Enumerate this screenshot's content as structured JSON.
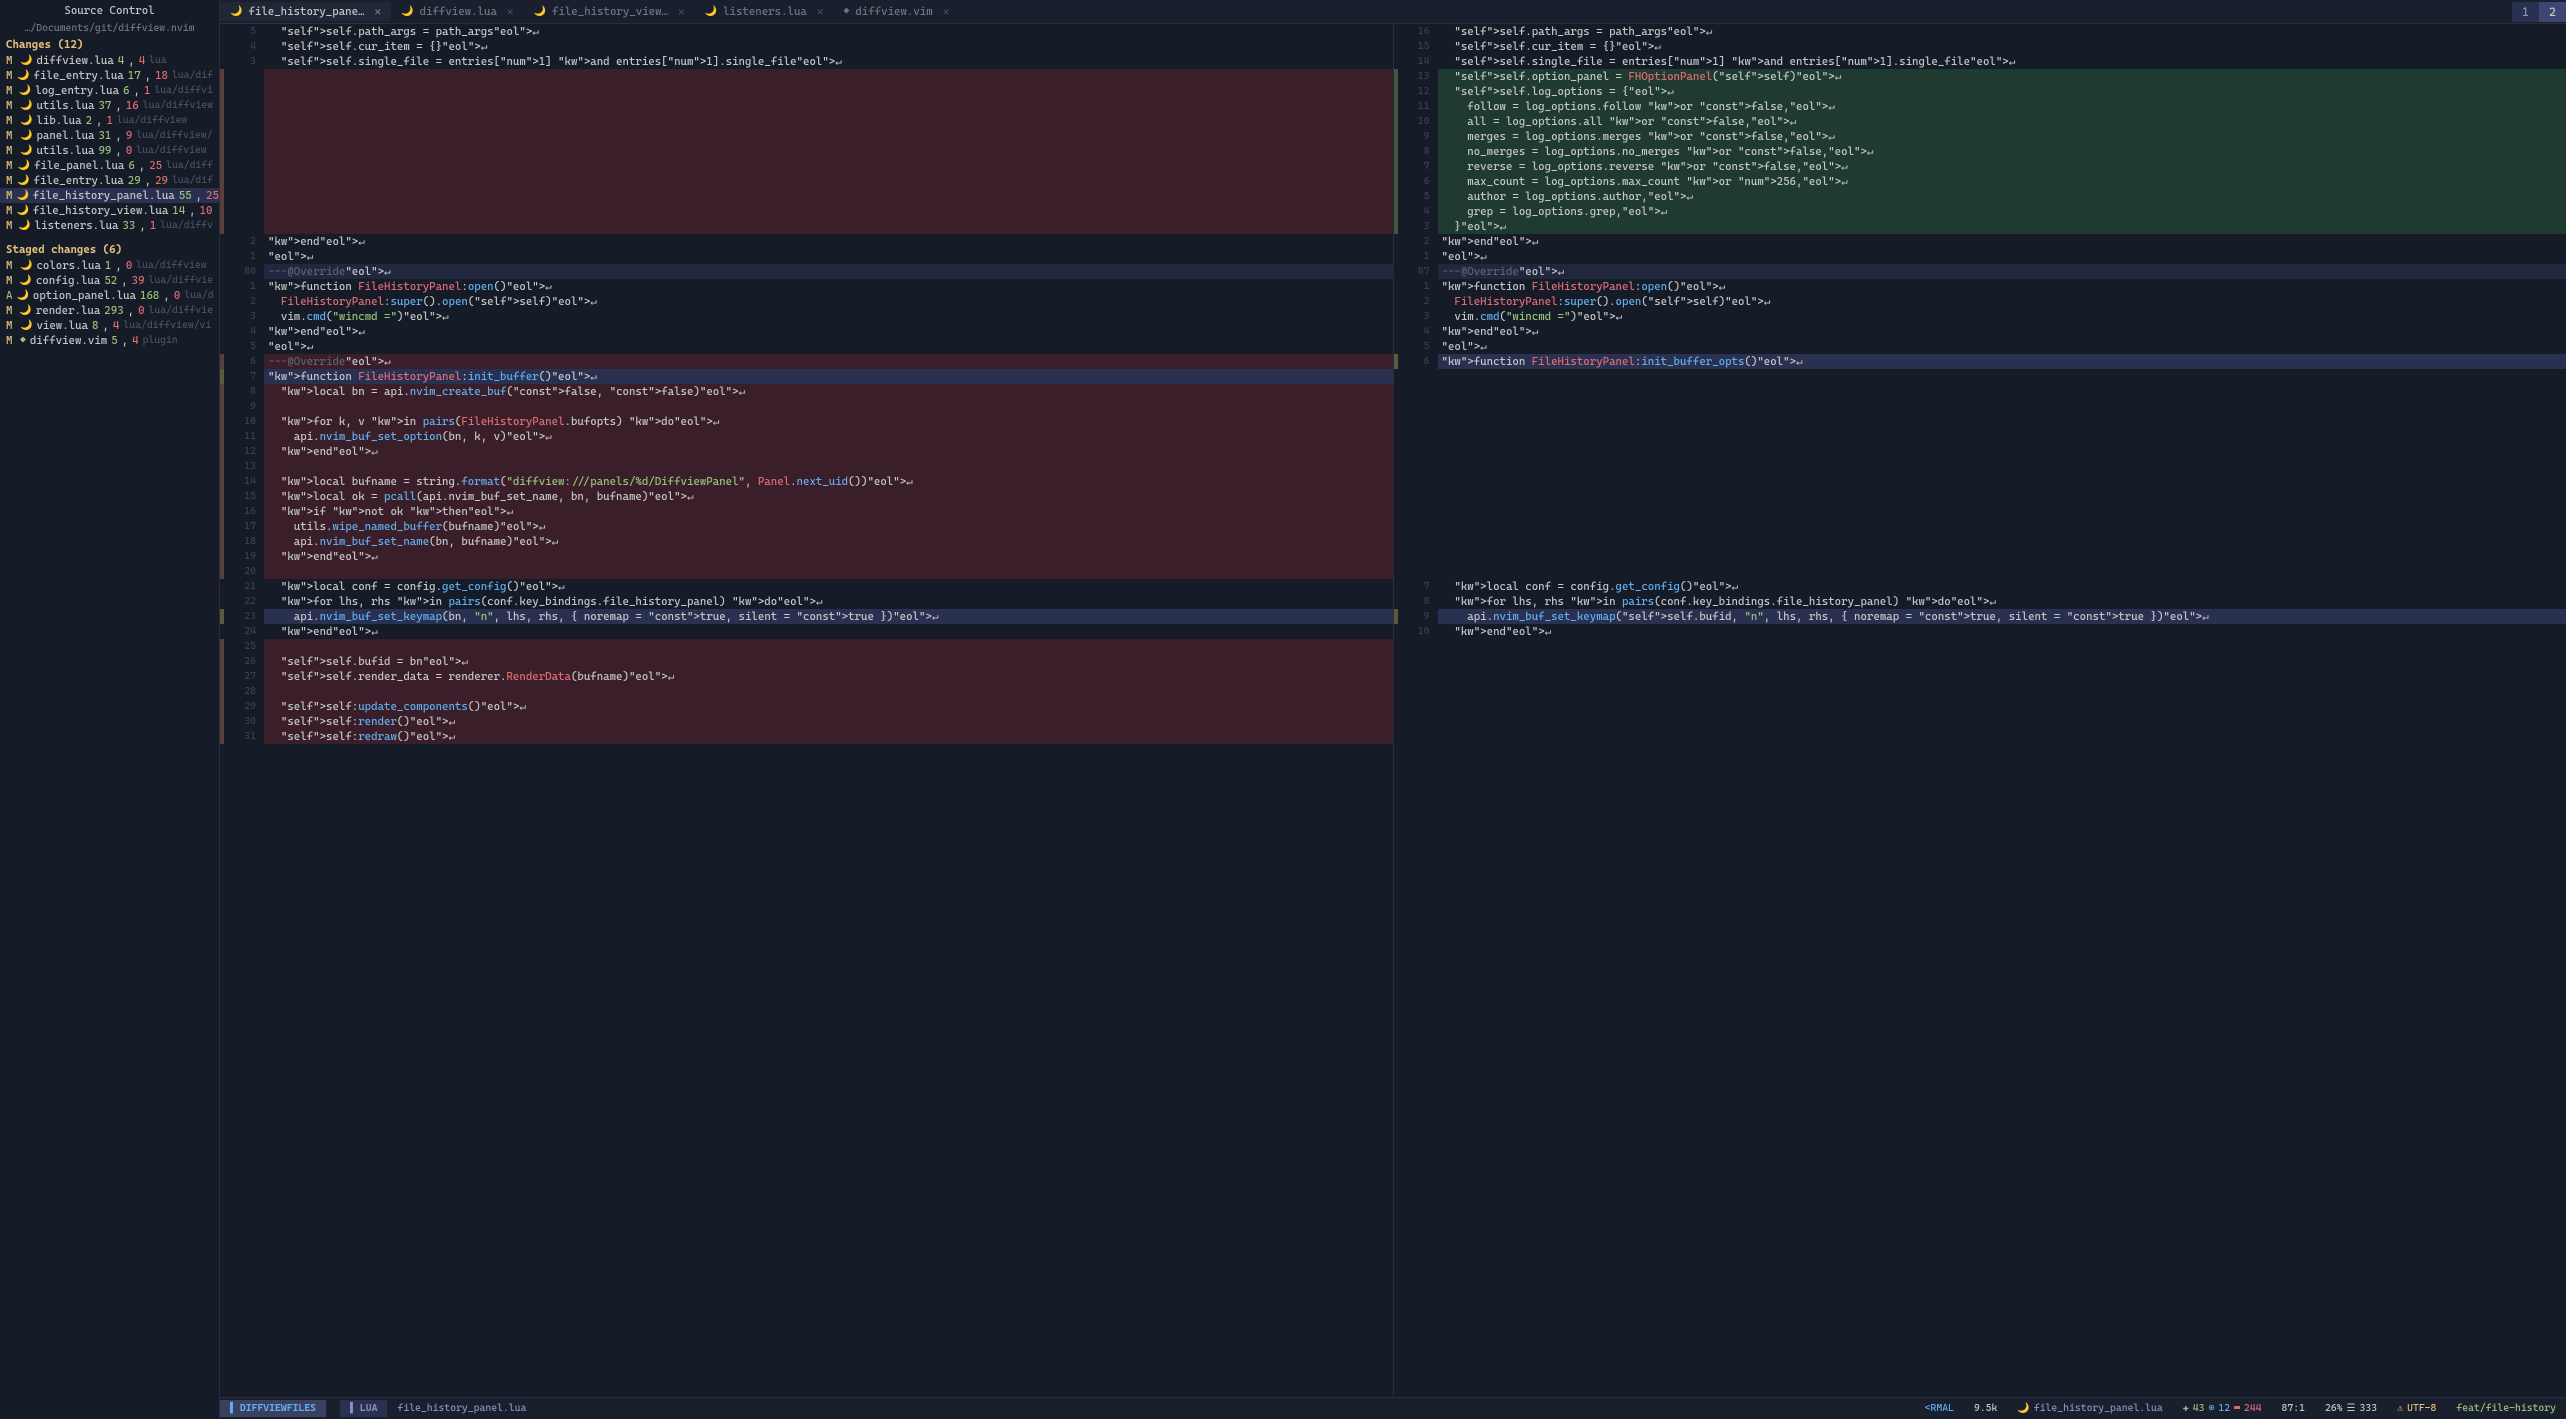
{
  "sidebar": {
    "title": "Source Control",
    "path": "…/Documents/git/diffview.nvim",
    "changes_header": "Changes (12)",
    "changes": [
      {
        "status": "M",
        "name": "diffview.lua",
        "add": "4",
        "del": "4",
        "path": "lua"
      },
      {
        "status": "M",
        "name": "file_entry.lua",
        "add": "17",
        "del": "18",
        "path": "lua/dif"
      },
      {
        "status": "M",
        "name": "log_entry.lua",
        "add": "6",
        "del": "1",
        "path": "lua/diffvi"
      },
      {
        "status": "M",
        "name": "utils.lua",
        "add": "37",
        "del": "16",
        "path": "lua/diffview"
      },
      {
        "status": "M",
        "name": "lib.lua",
        "add": "2",
        "del": "1",
        "path": "lua/diffview"
      },
      {
        "status": "M",
        "name": "panel.lua",
        "add": "31",
        "del": "9",
        "path": "lua/diffview/"
      },
      {
        "status": "M",
        "name": "utils.lua",
        "add": "99",
        "del": "0",
        "path": "lua/diffview"
      },
      {
        "status": "M",
        "name": "file_panel.lua",
        "add": "6",
        "del": "25",
        "path": "lua/diff"
      },
      {
        "status": "M",
        "name": "file_entry.lua",
        "add": "29",
        "del": "29",
        "path": "lua/dif"
      },
      {
        "status": "M",
        "name": "file_history_panel.lua",
        "add": "55",
        "del": "25",
        "path": "",
        "selected": true
      },
      {
        "status": "M",
        "name": "file_history_view.lua",
        "add": "14",
        "del": "10",
        "path": ""
      },
      {
        "status": "M",
        "name": "listeners.lua",
        "add": "33",
        "del": "1",
        "path": "lua/diffv"
      }
    ],
    "staged_header": "Staged changes (6)",
    "staged": [
      {
        "status": "M",
        "name": "colors.lua",
        "add": "1",
        "del": "0",
        "path": "lua/diffview"
      },
      {
        "status": "M",
        "name": "config.lua",
        "add": "52",
        "del": "39",
        "path": "lua/diffvie"
      },
      {
        "status": "A",
        "name": "option_panel.lua",
        "add": "168",
        "del": "0",
        "path": "lua/d"
      },
      {
        "status": "M",
        "name": "render.lua",
        "add": "293",
        "del": "0",
        "path": "lua/diffvie"
      },
      {
        "status": "M",
        "name": "view.lua",
        "add": "8",
        "del": "4",
        "path": "lua/diffview/vi"
      },
      {
        "status": "M",
        "name": "diffview.vim",
        "add": "5",
        "del": "4",
        "path": "plugin",
        "vim": true
      }
    ]
  },
  "tabs": [
    {
      "label": "file_history_pane…",
      "active": true,
      "icon": "🌙"
    },
    {
      "label": "diffview.lua",
      "icon": "🌙"
    },
    {
      "label": "file_history_view…",
      "icon": "🌙"
    },
    {
      "label": "listeners.lua",
      "icon": "🌙"
    },
    {
      "label": "diffview.vim",
      "icon": "◆"
    }
  ],
  "tab_nums": [
    "1",
    "2"
  ],
  "left_pane": {
    "gutter": [
      "5",
      "4",
      "3",
      "",
      "",
      "",
      "",
      "",
      "",
      "",
      "",
      "",
      "",
      "",
      "2",
      "1",
      "80",
      "1",
      "2",
      "3",
      "4",
      "5",
      "6",
      "7",
      "8",
      "9",
      "10",
      "11",
      "12",
      "13",
      "14",
      "15",
      "16",
      "17",
      "18",
      "19",
      "20",
      "21",
      "22",
      "23",
      "24",
      "25",
      "26",
      "27",
      "28",
      "29",
      "30",
      "31"
    ],
    "lines": [
      {
        "t": "  self.path_args = path_args↵"
      },
      {
        "t": "  self.cur_item = {}↵"
      },
      {
        "t": "  self.single_file = entries[1] and entries[1].single_file↵"
      },
      {
        "t": "",
        "cls": "bg-del"
      },
      {
        "t": "",
        "cls": "bg-del"
      },
      {
        "t": "",
        "cls": "bg-del"
      },
      {
        "t": "",
        "cls": "bg-del"
      },
      {
        "t": "",
        "cls": "bg-del"
      },
      {
        "t": "",
        "cls": "bg-del"
      },
      {
        "t": "",
        "cls": "bg-del"
      },
      {
        "t": "",
        "cls": "bg-del"
      },
      {
        "t": "",
        "cls": "bg-del"
      },
      {
        "t": "",
        "cls": "bg-del"
      },
      {
        "t": "",
        "cls": "bg-del"
      },
      {
        "t": "end↵"
      },
      {
        "t": "↵"
      },
      {
        "t": "---@Override↵",
        "cls": "cursor-line"
      },
      {
        "t": "function FileHistoryPanel:open()↵"
      },
      {
        "t": "  FileHistoryPanel:super().open(self)↵"
      },
      {
        "t": "  vim.cmd(\"wincmd =\")↵"
      },
      {
        "t": "end↵"
      },
      {
        "t": "↵"
      },
      {
        "t": "---@Override↵",
        "cls": "bg-del"
      },
      {
        "t": "function FileHistoryPanel:init_buffer()↵",
        "cls": "bg-change"
      },
      {
        "t": "  local bn = api.nvim_create_buf(false, false)↵",
        "cls": "bg-del"
      },
      {
        "t": "",
        "cls": "bg-del"
      },
      {
        "t": "  for k, v in pairs(FileHistoryPanel.bufopts) do↵",
        "cls": "bg-del"
      },
      {
        "t": "    api.nvim_buf_set_option(bn, k, v)↵",
        "cls": "bg-del"
      },
      {
        "t": "  end↵",
        "cls": "bg-del"
      },
      {
        "t": "",
        "cls": "bg-del"
      },
      {
        "t": "  local bufname = string.format(\"diffview:///panels/%d/DiffviewPanel\", Panel.next_uid())↵",
        "cls": "bg-del"
      },
      {
        "t": "  local ok = pcall(api.nvim_buf_set_name, bn, bufname)↵",
        "cls": "bg-del"
      },
      {
        "t": "  if not ok then↵",
        "cls": "bg-del"
      },
      {
        "t": "    utils.wipe_named_buffer(bufname)↵",
        "cls": "bg-del"
      },
      {
        "t": "    api.nvim_buf_set_name(bn, bufname)↵",
        "cls": "bg-del"
      },
      {
        "t": "  end↵",
        "cls": "bg-del"
      },
      {
        "t": "",
        "cls": "bg-del"
      },
      {
        "t": "  local conf = config.get_config()↵"
      },
      {
        "t": "  for lhs, rhs in pairs(conf.key_bindings.file_history_panel) do↵"
      },
      {
        "t": "    api.nvim_buf_set_keymap(bn, \"n\", lhs, rhs, { noremap = true, silent = true })↵",
        "cls": "bg-change"
      },
      {
        "t": "  end↵"
      },
      {
        "t": "",
        "cls": "bg-del"
      },
      {
        "t": "  self.bufid = bn↵",
        "cls": "bg-del"
      },
      {
        "t": "  self.render_data = renderer.RenderData(bufname)↵",
        "cls": "bg-del"
      },
      {
        "t": "",
        "cls": "bg-del"
      },
      {
        "t": "  self:update_components()↵",
        "cls": "bg-del"
      },
      {
        "t": "  self:render()↵",
        "cls": "bg-del"
      },
      {
        "t": "  self:redraw()↵",
        "cls": "bg-del"
      }
    ]
  },
  "right_pane": {
    "gutter": [
      "16",
      "15",
      "14",
      "13",
      "12",
      "11",
      "10",
      "9",
      "8",
      "7",
      "6",
      "5",
      "4",
      "3",
      "2",
      "1",
      "87",
      "1",
      "2",
      "3",
      "4",
      "5",
      "6",
      "",
      "",
      "",
      "",
      "",
      "",
      "",
      "",
      "",
      "",
      "",
      "",
      "",
      "",
      "7",
      "8",
      "9",
      "10"
    ],
    "lines": [
      {
        "t": "  self.path_args = path_args↵"
      },
      {
        "t": "  self.cur_item = {}↵"
      },
      {
        "t": "  self.single_file = entries[1] and entries[1].single_file↵"
      },
      {
        "t": "  self.option_panel = FHOptionPanel(self)↵",
        "cls": "bg-add"
      },
      {
        "t": "  self.log_options = {↵",
        "cls": "bg-add"
      },
      {
        "t": "    follow = log_options.follow or false,↵",
        "cls": "bg-add"
      },
      {
        "t": "    all = log_options.all or false,↵",
        "cls": "bg-add"
      },
      {
        "t": "    merges = log_options.merges or false,↵",
        "cls": "bg-add"
      },
      {
        "t": "    no_merges = log_options.no_merges or false,↵",
        "cls": "bg-add"
      },
      {
        "t": "    reverse = log_options.reverse or false,↵",
        "cls": "bg-add"
      },
      {
        "t": "    max_count = log_options.max_count or 256,↵",
        "cls": "bg-add"
      },
      {
        "t": "    author = log_options.author,↵",
        "cls": "bg-add"
      },
      {
        "t": "    grep = log_options.grep,↵",
        "cls": "bg-add"
      },
      {
        "t": "  }↵",
        "cls": "bg-add"
      },
      {
        "t": "end↵"
      },
      {
        "t": "↵"
      },
      {
        "t": "---@Override↵",
        "cls": "cursor-line"
      },
      {
        "t": "function FileHistoryPanel:open()↵"
      },
      {
        "t": "  FileHistoryPanel:super().open(self)↵"
      },
      {
        "t": "  vim.cmd(\"wincmd =\")↵"
      },
      {
        "t": "end↵"
      },
      {
        "t": "↵"
      },
      {
        "t": "function FileHistoryPanel:init_buffer_opts()↵",
        "cls": "bg-change"
      },
      {
        "t": ""
      },
      {
        "t": ""
      },
      {
        "t": ""
      },
      {
        "t": ""
      },
      {
        "t": ""
      },
      {
        "t": ""
      },
      {
        "t": ""
      },
      {
        "t": ""
      },
      {
        "t": ""
      },
      {
        "t": ""
      },
      {
        "t": ""
      },
      {
        "t": ""
      },
      {
        "t": ""
      },
      {
        "t": ""
      },
      {
        "t": "  local conf = config.get_config()↵"
      },
      {
        "t": "  for lhs, rhs in pairs(conf.key_bindings.file_history_panel) do↵"
      },
      {
        "t": "    api.nvim_buf_set_keymap(self.bufid, \"n\", lhs, rhs, { noremap = true, silent = true })↵",
        "cls": "bg-change"
      },
      {
        "t": "  end↵"
      }
    ]
  },
  "status": {
    "left_mode": "DIFFVIEWFILES",
    "lang": "LUA",
    "file": "file_history_panel.lua",
    "mode_r": "<RMAL",
    "size": "9.5k",
    "file_r": "file_history_panel.lua",
    "add": "43",
    "chg": "12",
    "del": "244",
    "pos": "87:1",
    "pct": "26%",
    "lines": "333",
    "enc": "UTF-8",
    "branch": "feat/file-history"
  }
}
